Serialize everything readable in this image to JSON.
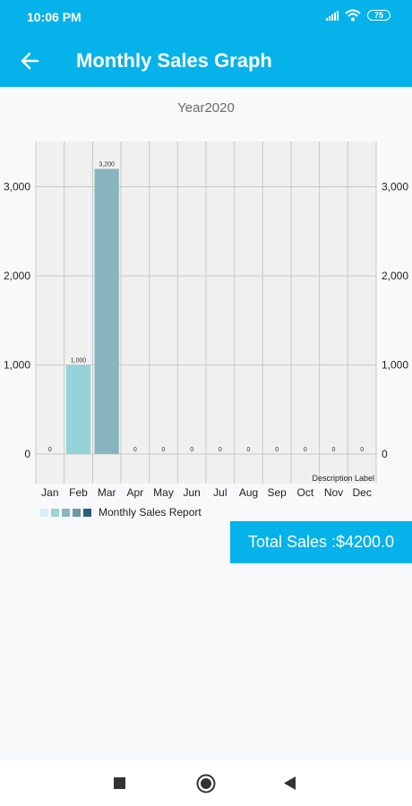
{
  "status": {
    "time": "10:06 PM",
    "battery": "75"
  },
  "header": {
    "title": "Monthly Sales Graph"
  },
  "chart_data": {
    "type": "bar",
    "title": "Year2020",
    "categories": [
      "Jan",
      "Feb",
      "Mar",
      "Apr",
      "May",
      "Jun",
      "Jul",
      "Aug",
      "Sep",
      "Oct",
      "Nov",
      "Dec"
    ],
    "series": [
      {
        "name": "Monthly Sales Report",
        "values": [
          0,
          1000,
          3200,
          0,
          0,
          0,
          0,
          0,
          0,
          0,
          0,
          0
        ]
      }
    ],
    "value_labels": [
      "0",
      "1,000",
      "3,200",
      "0",
      "0",
      "0",
      "0",
      "0",
      "0",
      "0",
      "0",
      "0"
    ],
    "y_ticks": [
      "0",
      "1,000",
      "2,000",
      "3,000"
    ],
    "y_tick_values": [
      0,
      1000,
      2000,
      3000
    ],
    "ylim": [
      0,
      3500
    ],
    "description": "Description Label",
    "grid": true,
    "legend_position": "bottom-left",
    "colors": {
      "bars": [
        "#c1e7ec",
        "#94d3d8",
        "#88b4bd",
        "#7aa0ab",
        "#2b5f75"
      ],
      "legend": [
        "#d3eef5",
        "#9ad3d8",
        "#88b6bf",
        "#6c9aa6",
        "#2c5e78"
      ],
      "plot_bg": "#f0f0f0",
      "grid": "#c8c8c8"
    }
  },
  "total": {
    "label": "Total Sales :$4200.0"
  },
  "colors": {
    "accent": "#05b2ea"
  },
  "nav": {
    "icons": [
      "stop-square-icon",
      "home-circle-icon",
      "back-triangle-icon"
    ]
  }
}
